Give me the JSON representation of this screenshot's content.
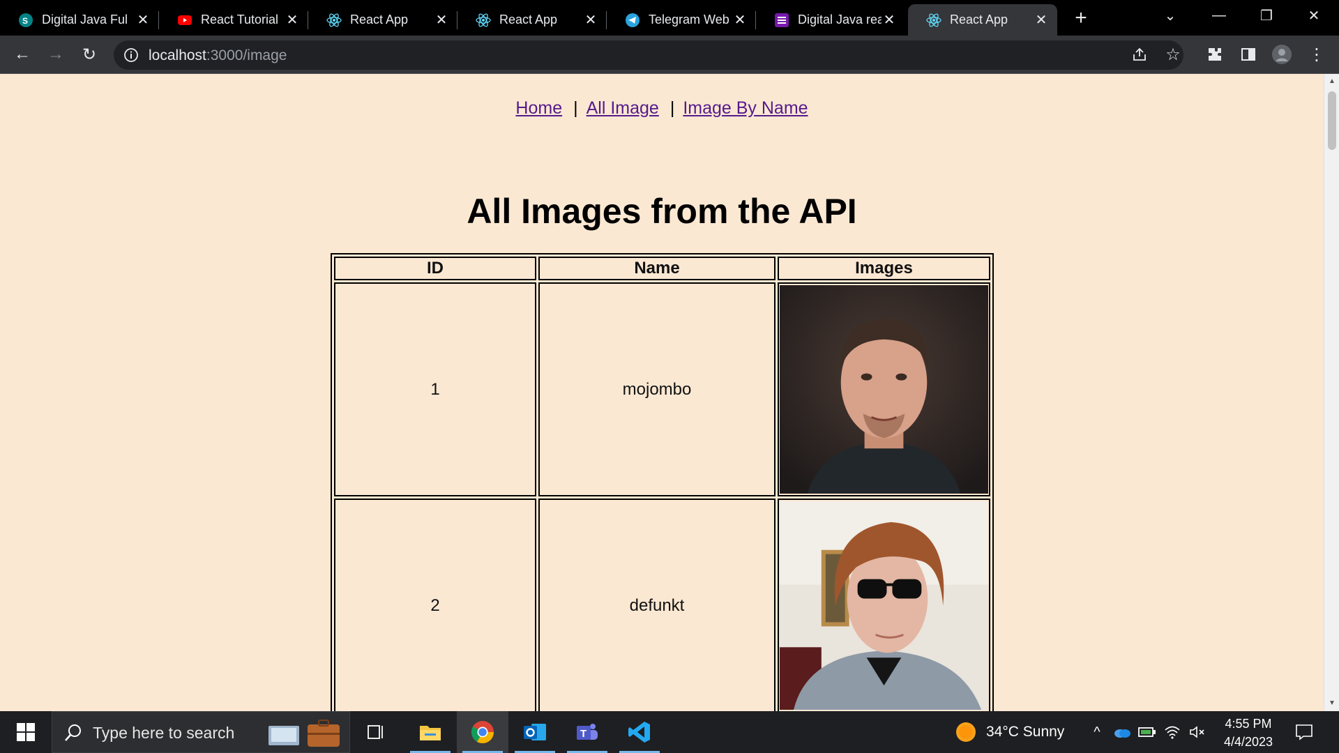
{
  "browser": {
    "tabs": [
      {
        "title": "Digital Java Ful",
        "icon": "sharepoint-icon",
        "color": "#038387"
      },
      {
        "title": "React Tutorial",
        "icon": "youtube-icon",
        "color": "#ff0000"
      },
      {
        "title": "React App",
        "icon": "react-icon",
        "color": "#61dafb"
      },
      {
        "title": "React App",
        "icon": "react-icon",
        "color": "#61dafb"
      },
      {
        "title": "Telegram Web",
        "icon": "telegram-icon",
        "color": "#2aa3df"
      },
      {
        "title": "Digital Java rea",
        "icon": "onenote-icon",
        "color": "#7719aa"
      },
      {
        "title": "React App",
        "icon": "react-icon",
        "color": "#61dafb",
        "active": true
      }
    ],
    "url_host": "localhost",
    "url_path": ":3000/image"
  },
  "page": {
    "nav": {
      "home": "Home",
      "separator": "|",
      "all_image": "All Image",
      "image_by_name": "Image By Name"
    },
    "title": "All Images from the API",
    "table": {
      "headers": [
        "ID",
        "Name",
        "Images"
      ],
      "rows": [
        {
          "id": "1",
          "name": "mojombo",
          "image": "portrait-photo"
        },
        {
          "id": "2",
          "name": "defunkt",
          "image": "portrait-photo-sunglasses"
        }
      ]
    }
  },
  "taskbar": {
    "search_placeholder": "Type here to search",
    "weather": "34°C  Sunny",
    "time": "4:55 PM",
    "date": "4/4/2023"
  },
  "colors": {
    "page_background": "#fbe8d3",
    "link": "#551a8b",
    "chrome_dark": "#35363a"
  }
}
